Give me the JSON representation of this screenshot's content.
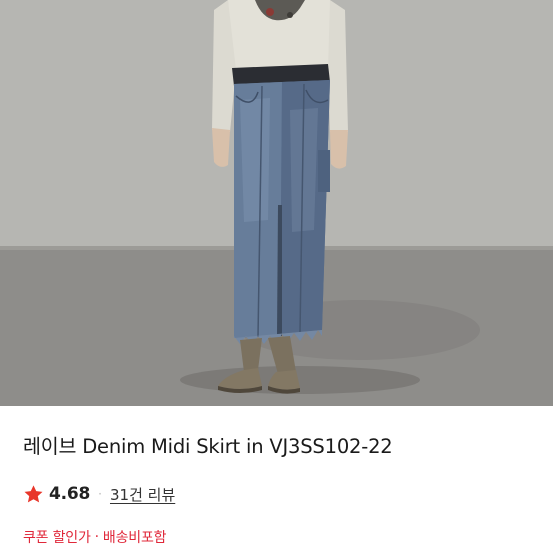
{
  "product": {
    "title": "레이브 Denim Midi Skirt in VJ3SS102-22",
    "image": {
      "description_icon": "product-photo"
    },
    "rating": {
      "icon": "star-icon",
      "value": "4.68",
      "separator": "·",
      "reviews_label": "31건 리뷰"
    },
    "tags": {
      "coupon": "쿠폰 할인가",
      "separator": "·",
      "shipping": "배송비포함"
    }
  },
  "colors": {
    "star": "#e8362a",
    "tag": "#e0283a",
    "title": "#1a1a1a",
    "background": "#ffffff"
  }
}
